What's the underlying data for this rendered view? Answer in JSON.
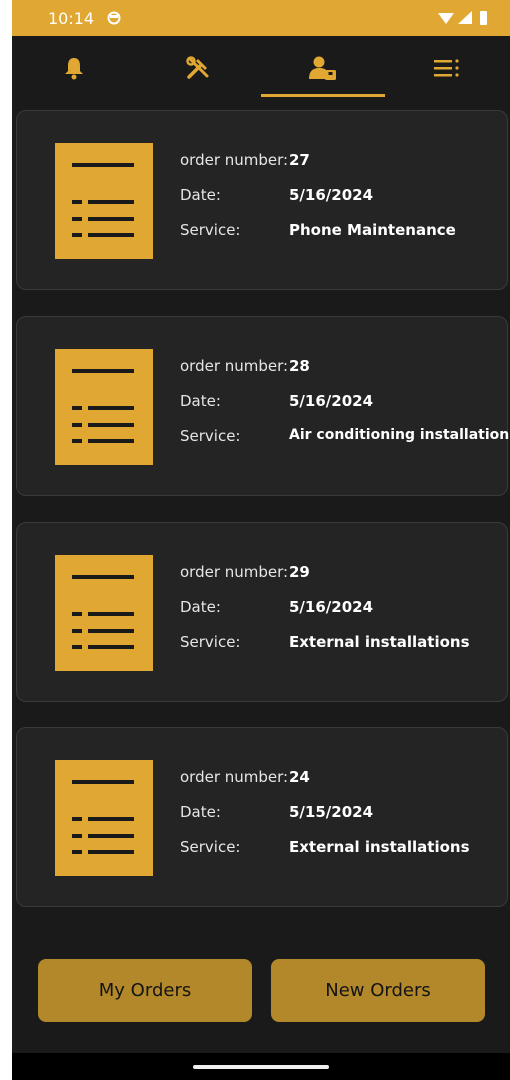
{
  "status_bar": {
    "time": "10:14"
  },
  "colors": {
    "accent": "#e0a732",
    "background": "#1a1a1a",
    "card": "#242424",
    "button": "#b2882a"
  },
  "tabs": [
    {
      "icon": "bell-icon"
    },
    {
      "icon": "tools-icon"
    },
    {
      "icon": "user-orders-icon",
      "selected": true
    },
    {
      "icon": "list-menu-icon"
    }
  ],
  "labels": {
    "order_number": "order number:",
    "date": "Date:",
    "service": "Service:"
  },
  "orders": [
    {
      "number": "27",
      "date": "5/16/2024",
      "service": "Phone Maintenance"
    },
    {
      "number": "28",
      "date": "5/16/2024",
      "service": "Air conditioning installation"
    },
    {
      "number": "29",
      "date": "5/16/2024",
      "service": "External installations"
    },
    {
      "number": "24",
      "date": "5/15/2024",
      "service": "External installations"
    }
  ],
  "buttons": {
    "my_orders": "My Orders",
    "new_orders": "New Orders"
  }
}
